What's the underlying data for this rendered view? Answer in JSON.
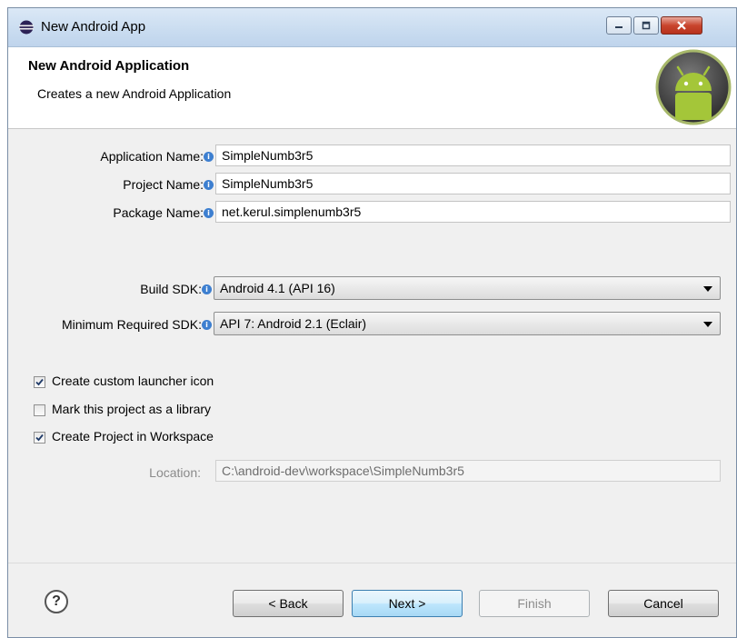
{
  "window": {
    "title": "New Android App"
  },
  "header": {
    "title": "New Android Application",
    "subtitle": "Creates a new Android Application"
  },
  "form": {
    "application_name": {
      "label": "Application Name:",
      "value": "SimpleNumb3r5"
    },
    "project_name": {
      "label": "Project Name:",
      "value": "SimpleNumb3r5"
    },
    "package_name": {
      "label": "Package Name:",
      "value": "net.kerul.simplenumb3r5"
    },
    "build_sdk": {
      "label": "Build SDK:",
      "value": "Android 4.1 (API 16)"
    },
    "min_sdk": {
      "label": "Minimum Required SDK:",
      "value": "API 7: Android 2.1 (Eclair)"
    }
  },
  "options": [
    {
      "label": "Create custom launcher icon",
      "checked": true
    },
    {
      "label": "Mark this project as a library",
      "checked": false
    },
    {
      "label": "Create Project in Workspace",
      "checked": true
    }
  ],
  "location": {
    "label": "Location:",
    "value": "C:\\android-dev\\workspace\\SimpleNumb3r5"
  },
  "buttons": {
    "help": "?",
    "back": "< Back",
    "next": "Next >",
    "finish": "Finish",
    "cancel": "Cancel"
  },
  "colors": {
    "info_icon": "#3d7fd0",
    "android_green": "#a4c639"
  }
}
